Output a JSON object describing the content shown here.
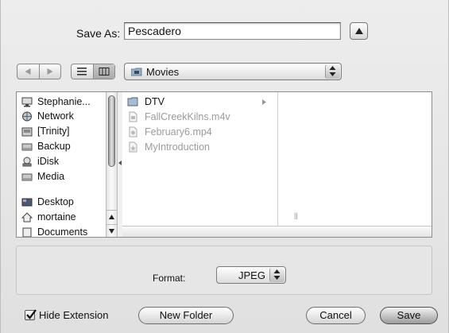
{
  "dialog": {
    "save_as_label": "Save As:",
    "filename": "Pescadero"
  },
  "toolbar": {
    "location": "Movies"
  },
  "sidebar": {
    "items": [
      {
        "label": "Stephanie...",
        "icon": "computer-icon"
      },
      {
        "label": "Network",
        "icon": "network-icon"
      },
      {
        "label": "[Trinity]",
        "icon": "drive-icon"
      },
      {
        "label": "Backup",
        "icon": "drive-icon"
      },
      {
        "label": "iDisk",
        "icon": "idisk-icon"
      },
      {
        "label": "Media",
        "icon": "drive-icon"
      },
      {
        "label": "Desktop",
        "icon": "desktop-icon"
      },
      {
        "label": "mortaine",
        "icon": "home-icon"
      },
      {
        "label": "Documents",
        "icon": "documents-icon"
      }
    ]
  },
  "files": [
    {
      "name": "DTV",
      "kind": "folder",
      "enabled": true
    },
    {
      "name": "FallCreekKilns.m4v",
      "kind": "file",
      "enabled": false
    },
    {
      "name": "February6.mp4",
      "kind": "file",
      "enabled": false
    },
    {
      "name": "MyIntroduction",
      "kind": "file",
      "enabled": false
    }
  ],
  "accessory": {
    "format_label": "Format:",
    "format_value": "JPEG"
  },
  "bottom": {
    "hide_extension_label": "Hide Extension",
    "hide_extension_checked": true,
    "new_folder_label": "New Folder",
    "cancel_label": "Cancel",
    "save_label": "Save"
  }
}
